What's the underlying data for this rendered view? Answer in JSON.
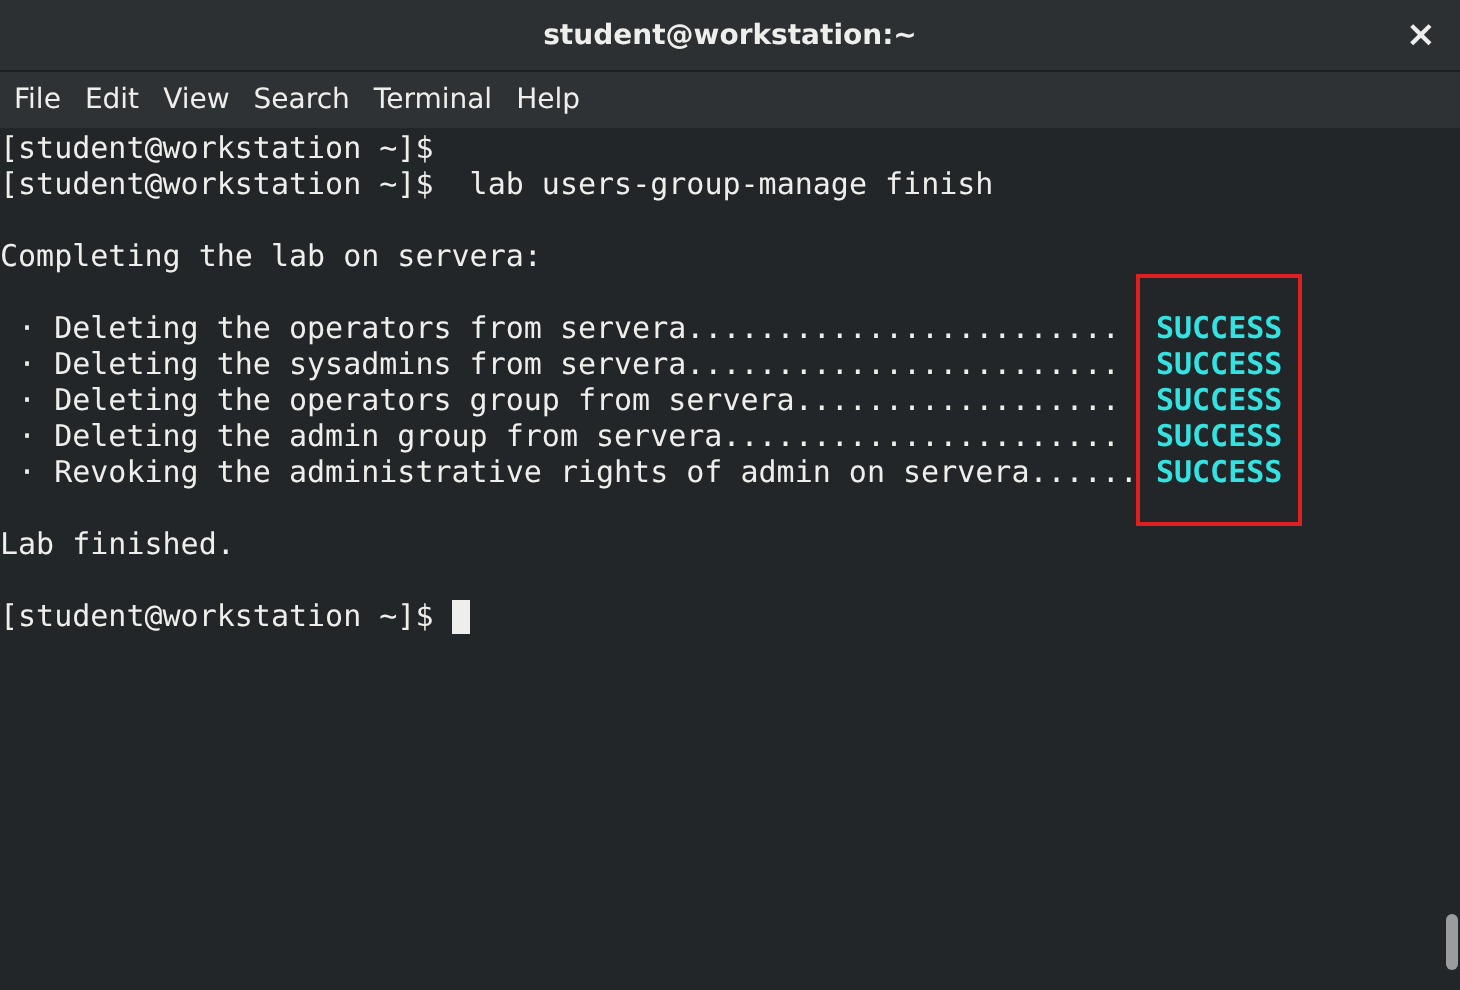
{
  "window": {
    "title": "student@workstation:~",
    "close": "×"
  },
  "menu": [
    "File",
    "Edit",
    "View",
    "Search",
    "Terminal",
    "Help"
  ],
  "terminal": {
    "lines": [
      {
        "kind": "prompt",
        "prompt": "[student@workstation ~]$"
      },
      {
        "kind": "prompt",
        "prompt": "[student@workstation ~]$",
        "command": "lab users-group-manage finish"
      },
      {
        "kind": "blank"
      },
      {
        "kind": "text",
        "text": "Completing the lab on servera:"
      },
      {
        "kind": "blank"
      },
      {
        "kind": "tasks",
        "highlighted": true,
        "items": [
          {
            "label": "· Deleting the operators from servera........................",
            "status": "SUCCESS"
          },
          {
            "label": "· Deleting the sysadmins from servera........................",
            "status": "SUCCESS"
          },
          {
            "label": "· Deleting the operators group from servera..................",
            "status": "SUCCESS"
          },
          {
            "label": "· Deleting the admin group from servera......................",
            "status": "SUCCESS"
          },
          {
            "label": "· Revoking the administrative rights of admin on servera......",
            "status": "SUCCESS"
          }
        ]
      },
      {
        "kind": "blank"
      },
      {
        "kind": "text",
        "text": "Lab finished."
      },
      {
        "kind": "blank"
      },
      {
        "kind": "prompt",
        "prompt": "[student@workstation ~]$",
        "cursor": true
      }
    ]
  }
}
